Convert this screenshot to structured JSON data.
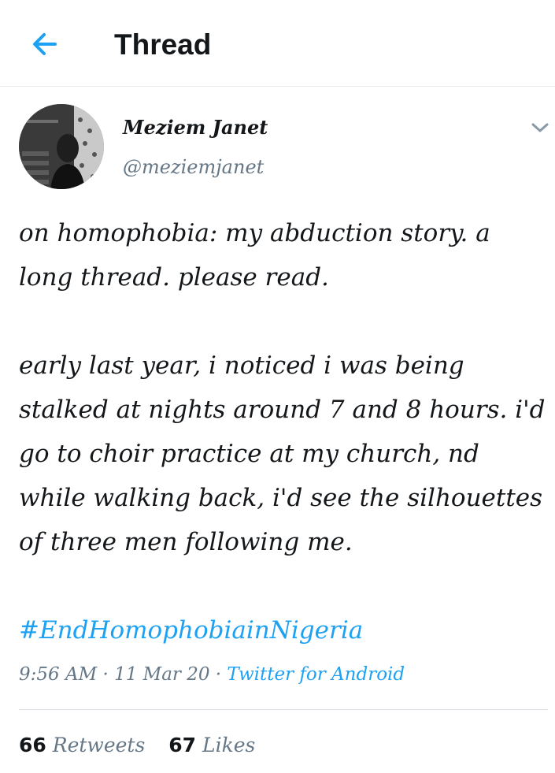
{
  "header": {
    "title": "Thread",
    "back_icon": "arrow-left-icon",
    "accent": "#1da1f2"
  },
  "tweet": {
    "author": {
      "name": "Meziem Janet",
      "handle": "@meziemjanet",
      "avatar_icon": "user-avatar"
    },
    "menu_icon": "chevron-down-icon",
    "body": "on homophobia: my abduction story. a long thread. please read.\n\nearly last year, i noticed i was being stalked at nights around 7 and 8 hours. i'd go to choir practice at my church, nd while walking back, i'd see the silhouettes of three men following me.",
    "hashtag": "#EndHomophobiainNigeria",
    "time": "9:56 AM",
    "date": "11 Mar 20",
    "source": "Twitter for Android",
    "separator": "·"
  },
  "stats": {
    "retweets_count": "66",
    "retweets_label": "Retweets",
    "likes_count": "67",
    "likes_label": "Likes"
  }
}
